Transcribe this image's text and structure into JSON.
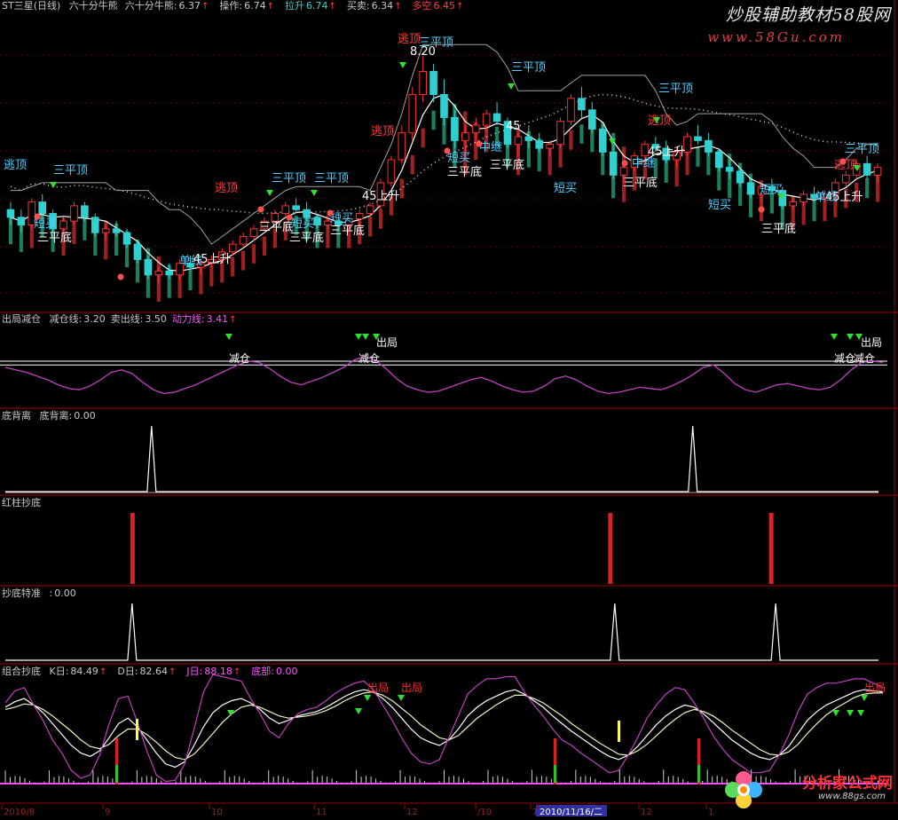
{
  "panel1": {
    "stock": "ST三星(日线)",
    "items": [
      {
        "label": "六十分牛熊",
        "value": "",
        "cls": "t-white"
      },
      {
        "label": "六十分牛熊:",
        "value": "6.37",
        "cls": "t-white",
        "arrow": "↑"
      },
      {
        "label": "操作:",
        "value": "6.74",
        "cls": "t-white",
        "arrow": "↑"
      },
      {
        "label": "拉升",
        "value": "6.74",
        "cls": "t-cyan",
        "arrow": "↑"
      },
      {
        "label": "买卖:",
        "value": "6.34",
        "cls": "t-white",
        "arrow": "↑"
      },
      {
        "label": "多空",
        "value": "6.45",
        "cls": "t-red",
        "arrow": "↑"
      }
    ]
  },
  "panel2": {
    "title": "出局减仓",
    "items": [
      {
        "label": "减仓线:",
        "value": "3.20",
        "cls": "t-white"
      },
      {
        "label": "卖出线:",
        "value": "3.50",
        "cls": "t-white"
      },
      {
        "label": "动力线:",
        "value": "3.41",
        "cls": "t-mag",
        "arrow": "↑"
      }
    ]
  },
  "panel3": {
    "title": "底背离",
    "items": [
      {
        "label": "底背离:",
        "value": "0.00",
        "cls": "t-white"
      }
    ]
  },
  "panel4": {
    "title": "红柱抄底",
    "items": []
  },
  "panel5": {
    "title": "抄底特准",
    "items": [
      {
        "label": ":",
        "value": "0.00",
        "cls": "t-white"
      }
    ]
  },
  "panel6": {
    "title": "组合抄底",
    "items": [
      {
        "label": "K日:",
        "value": "84.49",
        "cls": "t-white",
        "arrow": "↑"
      },
      {
        "label": "D日:",
        "value": "82.64",
        "cls": "t-white",
        "arrow": "↑"
      },
      {
        "label": "J日:",
        "value": "88.18",
        "cls": "t-mag",
        "arrow": "↑"
      },
      {
        "label": "底部:",
        "value": "0.00",
        "cls": "t-mag"
      }
    ]
  },
  "xaxis": {
    "labels": [
      "2010/8",
      "9",
      "10",
      "11",
      "12",
      "/10",
      "11",
      "2010/11/16/二",
      "12",
      "1"
    ]
  },
  "watermark_top": "炒股辅助教材58股网",
  "watermark_top_url": "www.58Gu.com",
  "watermark_bottom": "分析家公式网",
  "watermark_bottom_url": "www.88gs.com",
  "colors": {
    "panel_border": "#a00000",
    "up_candle": "#ff3030",
    "down_candle": "#30d0d0",
    "white_line": "#ffffff",
    "magenta": "#ff40ff",
    "yellow": "#ffff40",
    "green_bar": "#30c030",
    "gray_line": "#a0a0a0",
    "red_bar": "#dd2020"
  },
  "chart_data": [
    {
      "type": "candlestick",
      "title": "ST三星(日线)",
      "price_candles": [
        [
          6.2,
          6.3,
          6.0,
          6.1
        ],
        [
          6.1,
          6.2,
          5.9,
          6.0
        ],
        [
          6.0,
          6.35,
          5.95,
          6.3
        ],
        [
          6.3,
          6.4,
          6.1,
          6.15
        ],
        [
          6.15,
          6.2,
          5.9,
          5.95
        ],
        [
          5.95,
          6.1,
          5.85,
          6.05
        ],
        [
          6.05,
          6.3,
          6.0,
          6.25
        ],
        [
          6.25,
          6.3,
          6.05,
          6.1
        ],
        [
          6.1,
          6.15,
          5.85,
          5.9
        ],
        [
          5.9,
          6.0,
          5.8,
          5.95
        ],
        [
          5.95,
          6.05,
          5.85,
          5.9
        ],
        [
          5.9,
          5.95,
          5.7,
          5.75
        ],
        [
          5.75,
          5.8,
          5.5,
          5.55
        ],
        [
          5.55,
          5.6,
          5.3,
          5.35
        ],
        [
          5.35,
          5.45,
          5.25,
          5.4
        ],
        [
          5.4,
          5.5,
          5.3,
          5.35
        ],
        [
          5.35,
          5.55,
          5.3,
          5.5
        ],
        [
          5.5,
          5.6,
          5.4,
          5.45
        ],
        [
          5.45,
          5.55,
          5.35,
          5.5
        ],
        [
          5.5,
          5.6,
          5.45,
          5.55
        ],
        [
          5.55,
          5.7,
          5.5,
          5.65
        ],
        [
          5.65,
          5.8,
          5.6,
          5.75
        ],
        [
          5.75,
          5.9,
          5.7,
          5.85
        ],
        [
          5.85,
          6.0,
          5.8,
          5.95
        ],
        [
          5.95,
          6.1,
          5.9,
          6.05
        ],
        [
          6.05,
          6.2,
          6.0,
          6.15
        ],
        [
          6.15,
          6.3,
          6.1,
          6.25
        ],
        [
          6.25,
          6.35,
          6.15,
          6.2
        ],
        [
          6.2,
          6.3,
          6.05,
          6.1
        ],
        [
          6.1,
          6.15,
          5.95,
          6.0
        ],
        [
          6.0,
          6.1,
          5.95,
          6.05
        ],
        [
          6.05,
          6.15,
          5.95,
          6.0
        ],
        [
          6.0,
          6.1,
          5.95,
          6.08
        ],
        [
          6.08,
          6.2,
          6.0,
          6.15
        ],
        [
          6.15,
          6.3,
          6.1,
          6.25
        ],
        [
          6.25,
          6.6,
          6.2,
          6.55
        ],
        [
          6.55,
          6.9,
          6.5,
          6.85
        ],
        [
          6.85,
          7.3,
          6.8,
          7.2
        ],
        [
          7.2,
          7.8,
          7.1,
          7.7
        ],
        [
          7.7,
          8.2,
          7.6,
          8.0
        ],
        [
          8.0,
          8.1,
          7.6,
          7.7
        ],
        [
          7.7,
          7.9,
          7.3,
          7.4
        ],
        [
          7.4,
          7.5,
          7.0,
          7.1
        ],
        [
          7.1,
          7.3,
          6.9,
          7.2
        ],
        [
          7.2,
          7.4,
          7.1,
          7.3
        ],
        [
          7.3,
          7.5,
          7.2,
          7.45
        ],
        [
          7.45,
          7.6,
          7.3,
          7.35
        ],
        [
          7.35,
          7.4,
          7.0,
          7.05
        ],
        [
          7.05,
          7.2,
          6.9,
          7.15
        ],
        [
          7.15,
          7.3,
          7.0,
          7.1
        ],
        [
          7.1,
          7.2,
          6.95,
          7.0
        ],
        [
          7.0,
          7.1,
          6.9,
          7.05
        ],
        [
          7.05,
          7.4,
          7.0,
          7.35
        ],
        [
          7.35,
          7.7,
          7.3,
          7.65
        ],
        [
          7.65,
          7.8,
          7.4,
          7.5
        ],
        [
          7.5,
          7.6,
          7.2,
          7.25
        ],
        [
          7.25,
          7.3,
          6.9,
          6.95
        ],
        [
          6.95,
          7.05,
          6.6,
          6.65
        ],
        [
          6.65,
          6.8,
          6.55,
          6.75
        ],
        [
          6.75,
          6.95,
          6.7,
          6.9
        ],
        [
          6.9,
          7.1,
          6.85,
          7.05
        ],
        [
          7.05,
          7.15,
          6.95,
          7.0
        ],
        [
          7.0,
          7.1,
          6.8,
          6.85
        ],
        [
          6.85,
          7.0,
          6.75,
          6.95
        ],
        [
          6.95,
          7.2,
          6.9,
          7.15
        ],
        [
          7.15,
          7.3,
          7.05,
          7.1
        ],
        [
          7.1,
          7.2,
          6.9,
          6.95
        ],
        [
          6.95,
          7.0,
          6.7,
          6.75
        ],
        [
          6.75,
          6.85,
          6.6,
          6.7
        ],
        [
          6.7,
          6.75,
          6.5,
          6.55
        ],
        [
          6.55,
          6.6,
          6.35,
          6.4
        ],
        [
          6.4,
          6.55,
          6.3,
          6.5
        ],
        [
          6.5,
          6.6,
          6.4,
          6.45
        ],
        [
          6.45,
          6.5,
          6.2,
          6.25
        ],
        [
          6.25,
          6.35,
          6.2,
          6.3
        ],
        [
          6.3,
          6.45,
          6.25,
          6.4
        ],
        [
          6.4,
          6.5,
          6.3,
          6.35
        ],
        [
          6.35,
          6.45,
          6.3,
          6.4
        ],
        [
          6.4,
          6.6,
          6.35,
          6.55
        ],
        [
          6.55,
          6.7,
          6.5,
          6.65
        ],
        [
          6.65,
          6.85,
          6.6,
          6.8
        ],
        [
          6.8,
          6.9,
          6.6,
          6.65
        ],
        [
          6.65,
          6.8,
          6.55,
          6.75
        ]
      ],
      "y_range": [
        5.0,
        8.7
      ],
      "annotations": [
        "逃顶",
        "三平顶",
        "短买",
        "三平底",
        "逃顶",
        "三平顶",
        "三平顶",
        "三平底",
        "短买",
        "三平底",
        "短买",
        "三平底",
        "45上升",
        "单线",
        "45上升",
        "逃顶",
        "8.20",
        "三平顶",
        "逃顶",
        "中继",
        "短买",
        "三平底",
        "三平底",
        "45",
        "短买",
        "三平顶",
        "中继",
        "45上升",
        "三平底",
        "三平顶",
        "逃顶",
        "短买",
        "短买",
        "三平底",
        "45上升",
        "单线",
        "逃顶",
        "三平顶"
      ]
    },
    {
      "type": "line",
      "title": "出局减仓",
      "y_range": [
        0,
        6
      ],
      "reference_lines": [
        3.2,
        3.5
      ],
      "series": [
        {
          "name": "动力线",
          "values": [
            3.0,
            2.8,
            2.6,
            2.3,
            2.0,
            1.6,
            1.3,
            1.2,
            1.5,
            2.0,
            2.6,
            2.8,
            2.5,
            1.8,
            1.2,
            0.9,
            1.0,
            1.3,
            1.6,
            2.0,
            2.4,
            2.8,
            3.2,
            3.5,
            3.4,
            2.9,
            2.3,
            1.8,
            1.6,
            1.9,
            2.2,
            2.6,
            3.0,
            3.6,
            3.9,
            3.6,
            2.9,
            2.1,
            1.5,
            1.2,
            1.0,
            1.1,
            1.4,
            1.7,
            2.0,
            2.2,
            1.9,
            1.5,
            1.2,
            1.0,
            1.1,
            1.5,
            2.1,
            2.3,
            2.0,
            1.5,
            1.1,
            0.9,
            1.0,
            1.2,
            1.4,
            1.3,
            1.2,
            1.5,
            1.9,
            2.4,
            3.0,
            3.2,
            2.5,
            1.7,
            1.2,
            1.0,
            1.3,
            1.6,
            1.7,
            1.5,
            1.3,
            1.2,
            1.4,
            2.0,
            2.8,
            3.4,
            3.5,
            3.4
          ]
        }
      ],
      "annotations": [
        "减仓",
        "出局",
        "减仓",
        "减仓",
        "减仓",
        "出局"
      ]
    },
    {
      "type": "line",
      "title": "底背离",
      "y_range": [
        0,
        1
      ],
      "spikes_at": [
        30,
        141
      ]
    },
    {
      "type": "bar",
      "title": "红柱抄底",
      "y_range": [
        0,
        1
      ],
      "bars_at": [
        26,
        124,
        157
      ]
    },
    {
      "type": "line",
      "title": "抄底特准",
      "y_range": [
        0,
        1
      ],
      "spikes_at": [
        26,
        125,
        158
      ]
    },
    {
      "type": "line",
      "title": "组合抄底",
      "y_range": [
        0,
        100
      ],
      "series": [
        {
          "name": "K日",
          "values": [
            70,
            75,
            78,
            72,
            65,
            55,
            45,
            35,
            28,
            25,
            30,
            42,
            55,
            60,
            52,
            40,
            28,
            18,
            15,
            20,
            35,
            52,
            65,
            72,
            76,
            78,
            74,
            68,
            60,
            55,
            58,
            62,
            64,
            66,
            70,
            75,
            80,
            84,
            86,
            84,
            78,
            70,
            60,
            50,
            42,
            38,
            35,
            40,
            50,
            62,
            70,
            76,
            80,
            84,
            86,
            82,
            76,
            70,
            62,
            55,
            48,
            42,
            36,
            30,
            25,
            22,
            26,
            34,
            44,
            54,
            62,
            68,
            72,
            70,
            64,
            56,
            48,
            40,
            34,
            28,
            24,
            22,
            26,
            34,
            46,
            58,
            66,
            72,
            76,
            80,
            84,
            86,
            85,
            84
          ]
        },
        {
          "name": "D日",
          "values": [
            68,
            70,
            73,
            72,
            68,
            62,
            55,
            48,
            40,
            34,
            32,
            36,
            44,
            50,
            50,
            45,
            38,
            30,
            24,
            22,
            27,
            36,
            46,
            56,
            64,
            70,
            72,
            70,
            66,
            62,
            60,
            61,
            62,
            64,
            67,
            71,
            76,
            80,
            83,
            84,
            81,
            76,
            69,
            62,
            54,
            48,
            42,
            40,
            44,
            52,
            60,
            66,
            72,
            77,
            81,
            81,
            78,
            74,
            68,
            62,
            55,
            49,
            43,
            37,
            32,
            27,
            26,
            30,
            36,
            44,
            52,
            59,
            65,
            68,
            66,
            62,
            56,
            49,
            43,
            37,
            31,
            27,
            26,
            29,
            36,
            46,
            55,
            63,
            69,
            74,
            79,
            82,
            83,
            83
          ]
        },
        {
          "name": "J日",
          "values": [
            74,
            85,
            88,
            72,
            58,
            40,
            28,
            12,
            5,
            8,
            26,
            55,
            78,
            80,
            56,
            30,
            8,
            2,
            3,
            18,
            50,
            84,
            100,
            98,
            96,
            94,
            78,
            64,
            48,
            42,
            55,
            64,
            68,
            70,
            76,
            83,
            88,
            92,
            94,
            86,
            72,
            58,
            42,
            28,
            20,
            18,
            22,
            42,
            62,
            82,
            90,
            96,
            96,
            98,
            98,
            84,
            72,
            62,
            50,
            40,
            35,
            28,
            22,
            16,
            10,
            12,
            26,
            42,
            60,
            72,
            82,
            88,
            86,
            74,
            60,
            44,
            32,
            22,
            16,
            10,
            10,
            12,
            26,
            44,
            66,
            82,
            88,
            92,
            92,
            94,
            96,
            96,
            92,
            88
          ]
        }
      ],
      "annotations": [
        "出局",
        "出局",
        "出局"
      ]
    }
  ]
}
